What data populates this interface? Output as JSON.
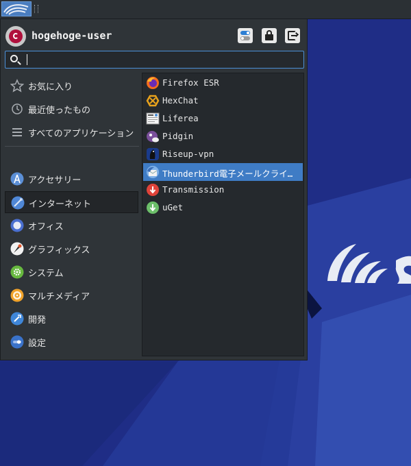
{
  "user": {
    "name": "hogehoge-user"
  },
  "search": {
    "placeholder": ""
  },
  "header_buttons": [
    "settings-icon",
    "lock-icon",
    "logout-icon"
  ],
  "categories": [
    {
      "label": "お気に入り",
      "icon": "star-icon"
    },
    {
      "label": "最近使ったもの",
      "icon": "clock-icon"
    },
    {
      "label": "すべてのアプリケーション",
      "icon": "list-icon"
    },
    {
      "label": "アクセサリー",
      "icon": "accessories-icon"
    },
    {
      "label": "インターネット",
      "icon": "internet-icon",
      "selected": true
    },
    {
      "label": "オフィス",
      "icon": "office-icon"
    },
    {
      "label": "グラフィックス",
      "icon": "graphics-icon"
    },
    {
      "label": "システム",
      "icon": "system-icon"
    },
    {
      "label": "マルチメディア",
      "icon": "multimedia-icon"
    },
    {
      "label": "開発",
      "icon": "development-icon"
    },
    {
      "label": "設定",
      "icon": "settings-category-icon"
    }
  ],
  "apps": [
    {
      "label": "Firefox ESR",
      "icon": "firefox-icon"
    },
    {
      "label": "HexChat",
      "icon": "hexchat-icon"
    },
    {
      "label": "Liferea",
      "icon": "liferea-icon"
    },
    {
      "label": "Pidgin",
      "icon": "pidgin-icon"
    },
    {
      "label": "Riseup-vpn",
      "icon": "riseup-vpn-icon"
    },
    {
      "label": "Thunderbird電子メールクライ…",
      "icon": "thunderbird-icon",
      "selected": true
    },
    {
      "label": "Transmission",
      "icon": "transmission-icon"
    },
    {
      "label": "uGet",
      "icon": "uget-icon"
    }
  ],
  "colors": {
    "accent": "#3f7cc5",
    "menu_bg": "#2f3438",
    "desktop_bg": "#1e2f8a"
  }
}
